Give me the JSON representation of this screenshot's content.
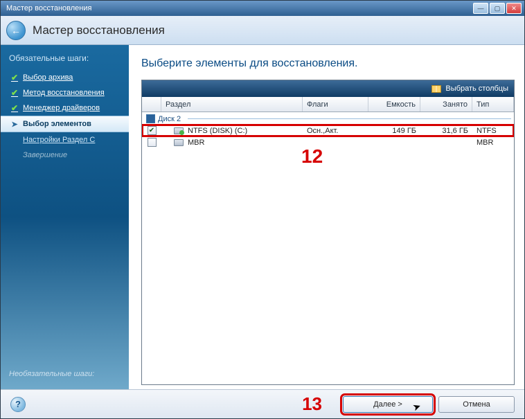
{
  "window": {
    "title": "Мастер восстановления",
    "header_title": "Мастер восстановления"
  },
  "sidebar": {
    "mandatory_label": "Обязательные шаги:",
    "optional_label": "Необязательные шаги:",
    "items": [
      {
        "label": "Выбор архива",
        "done": true
      },
      {
        "label": "Метод восстановления",
        "done": true
      },
      {
        "label": "Менеджер драйверов",
        "done": true
      },
      {
        "label": "Выбор элементов",
        "active": true
      },
      {
        "label": "Настройки Раздел C",
        "sub": true
      },
      {
        "label": "Завершение",
        "disabled": true
      }
    ]
  },
  "main": {
    "heading": "Выберите элементы для восстановления.",
    "columns_button": "Выбрать столбцы"
  },
  "columns": {
    "partition": "Раздел",
    "flags": "Флаги",
    "capacity": "Емкость",
    "used": "Занято",
    "type": "Тип"
  },
  "grid": {
    "disk_label": "Диск 2",
    "rows": [
      {
        "checked": true,
        "name": "NTFS (DISK) (C:)",
        "flags": "Осн.,Акт.",
        "capacity": "149 ГБ",
        "used": "31,6 ГБ",
        "type": "NTFS",
        "highlight": true,
        "green": true
      },
      {
        "checked": false,
        "name": "MBR",
        "flags": "",
        "capacity": "",
        "used": "",
        "type": "MBR",
        "highlight": false,
        "green": false
      }
    ]
  },
  "annotations": {
    "a12": "12",
    "a13": "13"
  },
  "footer": {
    "next": "Далее >",
    "cancel": "Отмена",
    "help": "?"
  }
}
